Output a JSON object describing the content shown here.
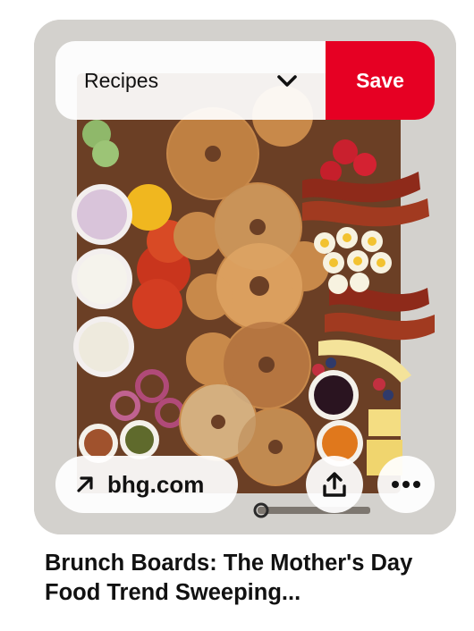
{
  "pin": {
    "board_selector": {
      "label": "Recipes",
      "icon": "chevron-down-icon"
    },
    "save_label": "Save",
    "source": {
      "domain": "bhg.com",
      "icon": "arrow-up-right-icon"
    },
    "share_icon": "share-upload-icon",
    "more_icon": "ellipsis-icon",
    "title": "Brunch Boards: The Mother's Day Food Trend Sweeping..."
  },
  "colors": {
    "save_red": "#e60023",
    "text": "#111111",
    "overlay_white": "#ffffff"
  }
}
